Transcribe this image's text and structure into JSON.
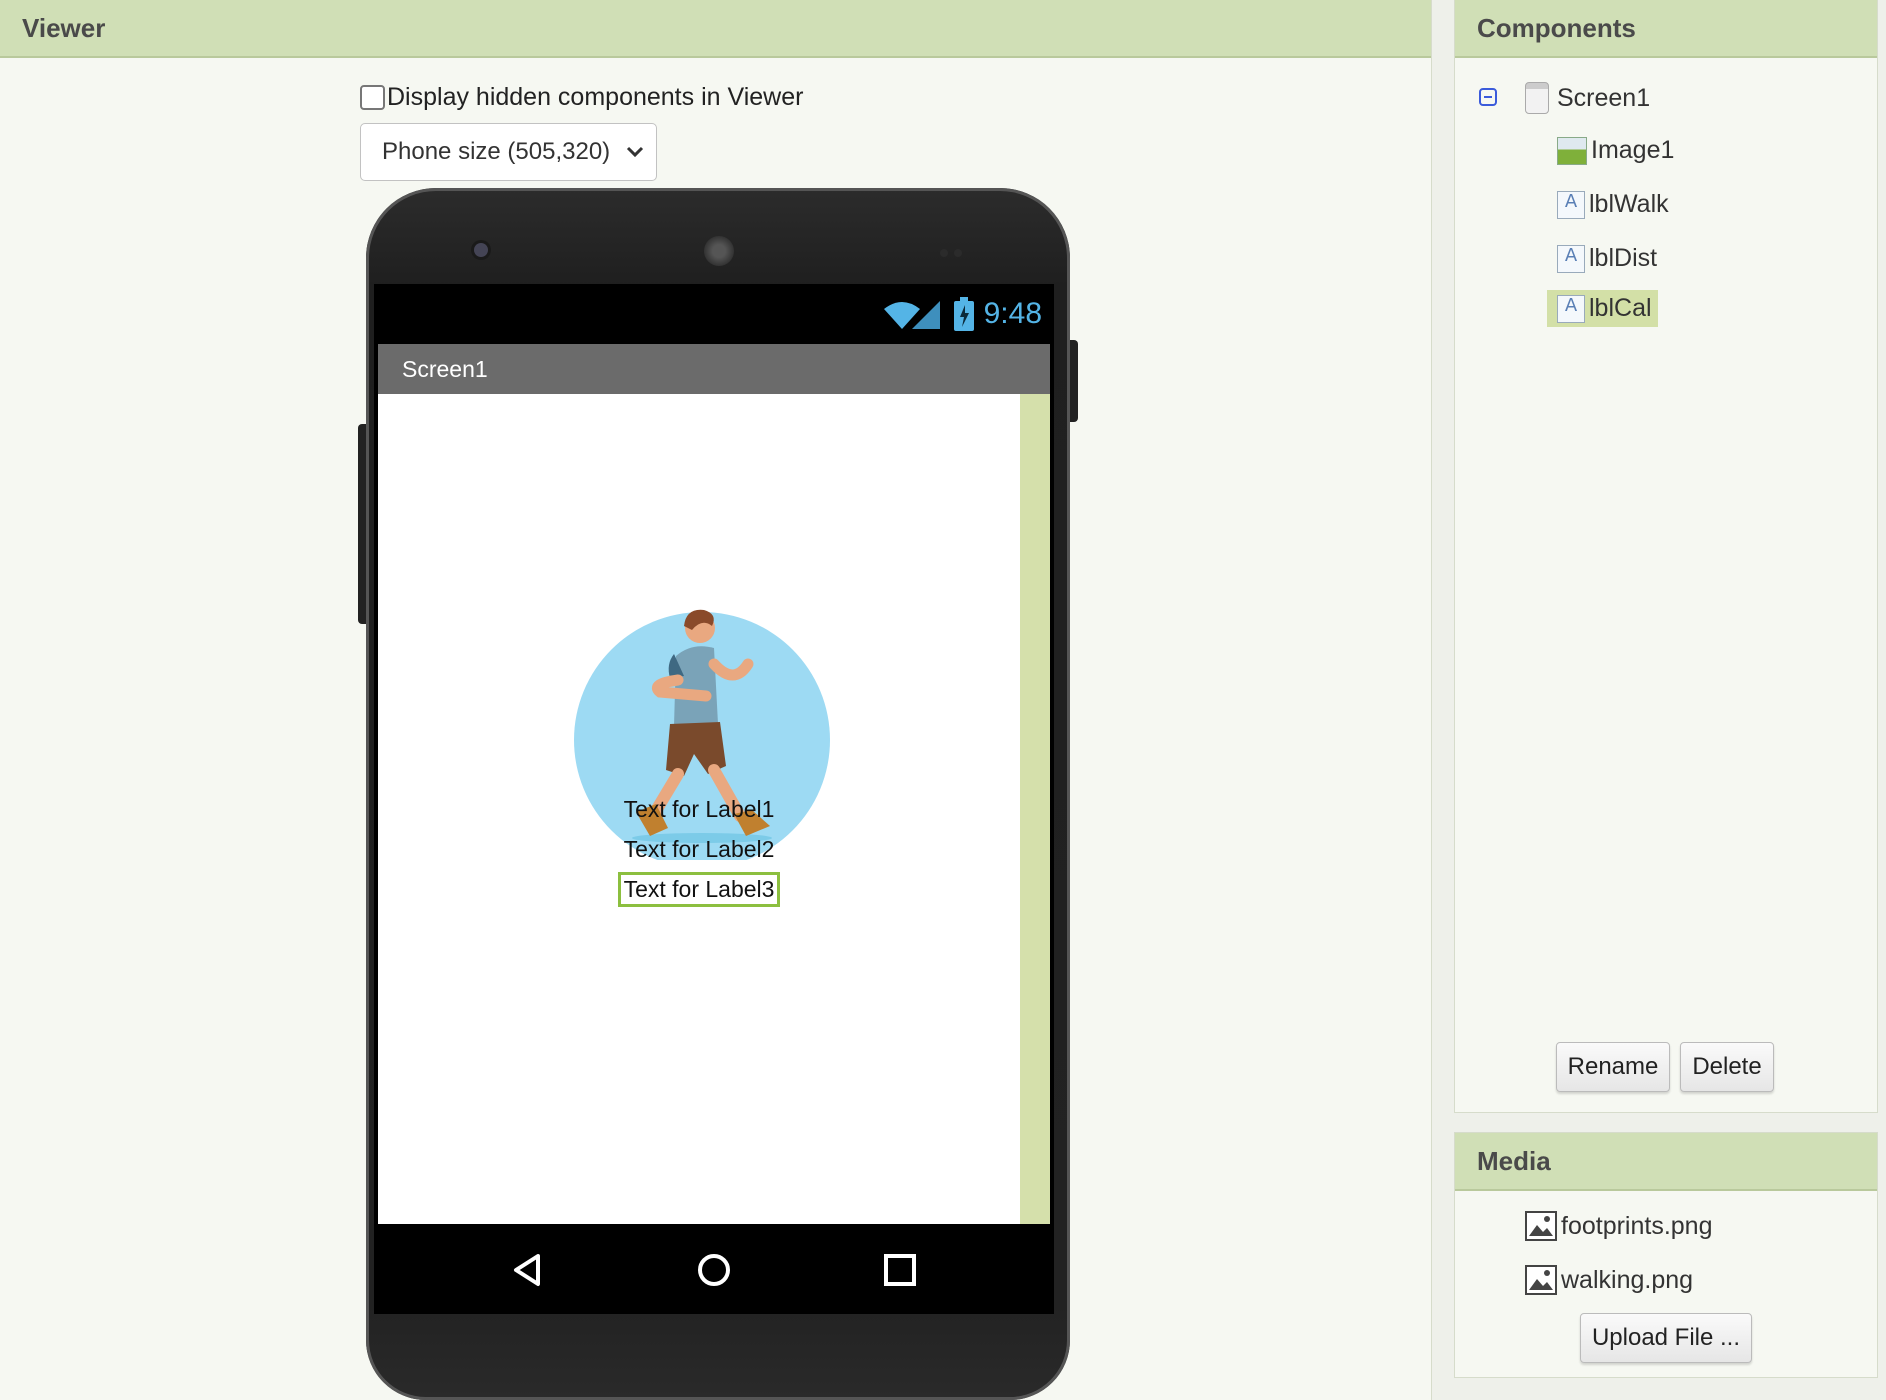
{
  "viewer": {
    "title": "Viewer",
    "hidden_components_label": "Display hidden components in Viewer",
    "hidden_components_checked": false,
    "size_select_value": "Phone size (505,320)"
  },
  "phone": {
    "status_time": "9:48",
    "screen_title": "Screen1",
    "labels": [
      "Text for Label1",
      "Text for Label2",
      "Text for Label3"
    ],
    "selected_label_index": 2
  },
  "components": {
    "title": "Components",
    "tree": [
      {
        "name": "Screen1",
        "icon": "screen-icon",
        "selected": false
      },
      {
        "name": "Image1",
        "icon": "image-icon",
        "selected": false
      },
      {
        "name": "lblWalk",
        "icon": "label-icon",
        "selected": false
      },
      {
        "name": "lblDist",
        "icon": "label-icon",
        "selected": false
      },
      {
        "name": "lblCal",
        "icon": "label-icon",
        "selected": true
      }
    ],
    "rename_label": "Rename",
    "delete_label": "Delete"
  },
  "media": {
    "title": "Media",
    "files": [
      "footprints.png",
      "walking.png"
    ],
    "upload_label": "Upload File ..."
  },
  "colors": {
    "header_bg": "#d0dfb6",
    "selection": "#d3e0a7",
    "label_selected_border": "#8cbf3f",
    "status_accent": "#54b4e6"
  }
}
